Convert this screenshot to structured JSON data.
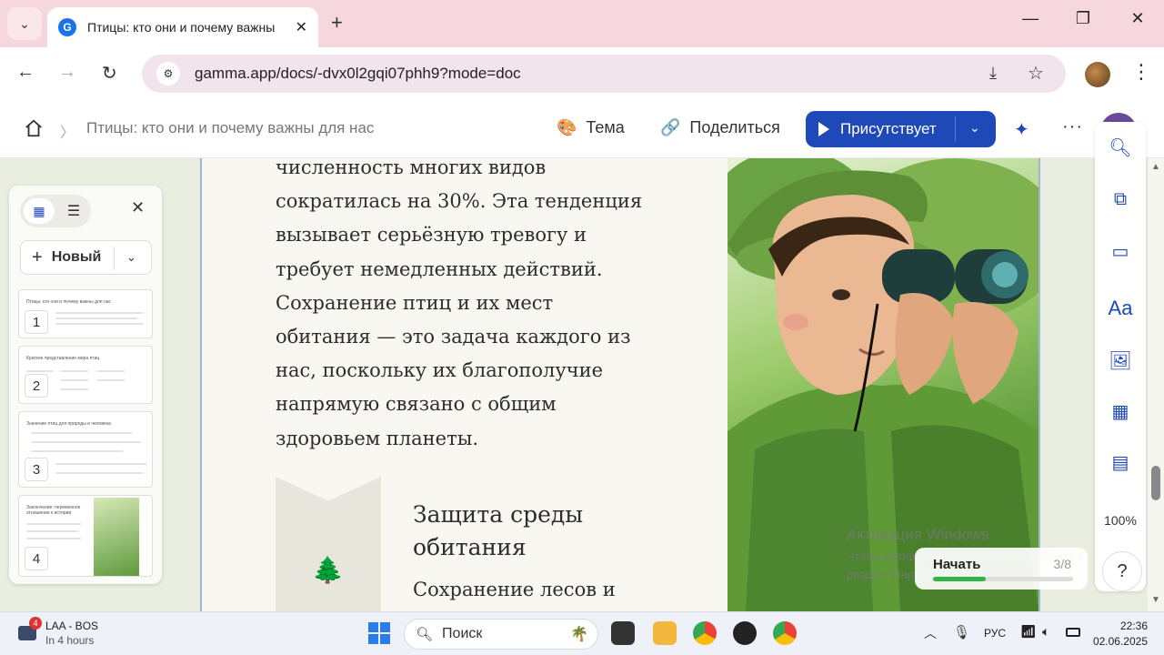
{
  "browser": {
    "tab_title": "Птицы: кто они и почему важны",
    "url": "gamma.app/docs/-dvx0l2gqi07phh9?mode=doc"
  },
  "header": {
    "breadcrumb": "Птицы: кто они и почему важны для нас",
    "theme_label": "Тема",
    "share_label": "Поделиться",
    "present_label": "Присутствует"
  },
  "sidebar": {
    "new_label": "Новый",
    "slides": [
      {
        "num": "1",
        "title": "Птицы: кто они и почему важны для нас"
      },
      {
        "num": "2",
        "title": "Краткое представление мира птиц"
      },
      {
        "num": "3",
        "title": "Значение птиц для природы и человека"
      },
      {
        "num": "4",
        "title": "Заключение: переменное отношение к истории"
      }
    ]
  },
  "doc": {
    "lines": [
      "численность многих видов",
      "сократилась на 30%. Эта тенденция",
      "вызывает серьёзную тревогу и",
      "требует немедленных действий.",
      "Сохранение птиц и их мест",
      "обитания — это задача каждого из",
      "нас, поскольку их благополучие",
      "напрямую связано с общим",
      "здоровьем планеты."
    ],
    "card_heading": "Защита среды обитания",
    "card_text": "Сохранение лесов и"
  },
  "rail": {
    "zoom": "100%",
    "help": "?"
  },
  "watermark": {
    "line1": "Активация Windows",
    "line2": "Чтобы активировать Windows, перейдите в",
    "line3": "раздел \"Параметры\"."
  },
  "progress": {
    "label": "Начать",
    "count": "3/8",
    "fraction": 0.375
  },
  "taskbar": {
    "badge": "4",
    "title": "LAA - BOS",
    "subtitle": "In 4 hours",
    "search_placeholder": "Поиск",
    "lang": "РУС",
    "time": "22:36",
    "date": "02.06.2025"
  },
  "colors": {
    "accent": "#1f48b8",
    "progress": "#33b44a",
    "tabstrip": "#f5d7dd"
  }
}
